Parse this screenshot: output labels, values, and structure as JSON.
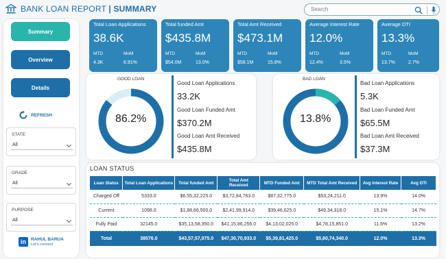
{
  "header": {
    "title_main": "BANK LOAN REPORT",
    "title_sep": "|",
    "title_sub": "SUMMARY",
    "search_placeholder": "Search"
  },
  "nav": {
    "summary": "Summary",
    "overview": "Overview",
    "details": "Details",
    "refresh": "REFRESH"
  },
  "filters": [
    {
      "label": "STATE",
      "value": "All"
    },
    {
      "label": "GRADE",
      "value": "All"
    },
    {
      "label": "PURPOSE",
      "value": "All"
    }
  ],
  "profile": {
    "name": "RAHUL BARUA",
    "tagline": "Let's connect"
  },
  "kpis": [
    {
      "title": "Total Loan Applications",
      "value": "38.6K",
      "mtd_label": "MTD",
      "mom_label": "MoM",
      "mtd": "4.3K",
      "mom": "6.91%"
    },
    {
      "title": "Total funded Amt",
      "value": "$435.8M",
      "mtd_label": "MTD",
      "mom_label": "MoM",
      "mtd": "$54.0M",
      "mom": "13.0%"
    },
    {
      "title": "Total Amt Received",
      "value": "$473.1M",
      "mtd_label": "MTD",
      "mom_label": "MoM",
      "mtd": "$58.1M",
      "mom": "15.8%"
    },
    {
      "title": "Average Interest Rate",
      "value": "12.0%",
      "mtd_label": "MTD",
      "mom_label": "MoM",
      "mtd": "12.4%",
      "mom": "3.5%"
    },
    {
      "title": "Average DTI",
      "value": "13.3%",
      "mtd_label": "MTD",
      "mom_label": "MoM",
      "mtd": "13.7%",
      "mom": "2.7%"
    }
  ],
  "good_loan": {
    "title": "GOOD LOAN",
    "percent_label": "86.2%",
    "percent": 86.2,
    "apps_label": "Good Loan Applications",
    "apps": "33.2K",
    "funded_label": "Good Loan Funded Amt",
    "funded": "$370.2M",
    "received_label": "Good Loan Amt Received",
    "received": "$435.8M"
  },
  "bad_loan": {
    "title": "BAD LOAN",
    "percent_label": "13.8%",
    "percent": 13.8,
    "apps_label": "Bad Loan Applications",
    "apps": "5.3K",
    "funded_label": "Bad Loan Funded Amt",
    "funded": "$65.5M",
    "received_label": "Bad Loan Amt Received",
    "received": "$37.3M"
  },
  "loan_status": {
    "title": "LOAN STATUS",
    "columns": [
      "Loan Status",
      "Total Loan Applications",
      "Total funded Amt",
      "Total Amt Received",
      "MTD Funded Amt",
      "MTD Total Amt Received",
      "Avg Interest Rate",
      "Avg DTI"
    ],
    "rows": [
      [
        "Charged Off",
        "5333.0",
        "$6,55,32,225.0",
        "$3,72,84,763.0",
        "$87,32,775.0",
        "$53,24,211.0",
        "13.9%",
        "14.0%"
      ],
      [
        "Current",
        "1098.0",
        "$1,88,66,500.0",
        "$2,41,99,914.0",
        "$39,46,625.0",
        "$49,34,318.0",
        "15.1%",
        "14.7%"
      ],
      [
        "Fully Paid",
        "32145.0",
        "$35,13,58,350.0",
        "$41,15,86,256.0",
        "$4,13,02,025.0",
        "$4,78,15,851.0",
        "11.6%",
        "13.2%"
      ]
    ],
    "total": [
      "Total",
      "38576.0",
      "$43,57,57,075.0",
      "$47,30,70,933.0",
      "$5,39,81,425.0",
      "$5,80,74,340.0",
      "12.0%",
      "13.3%"
    ]
  },
  "colors": {
    "primary": "#1e6fa8",
    "kpi_bg": "#2e86b8",
    "teal": "#2ab5ac",
    "donut_track": "#d9eef2"
  }
}
